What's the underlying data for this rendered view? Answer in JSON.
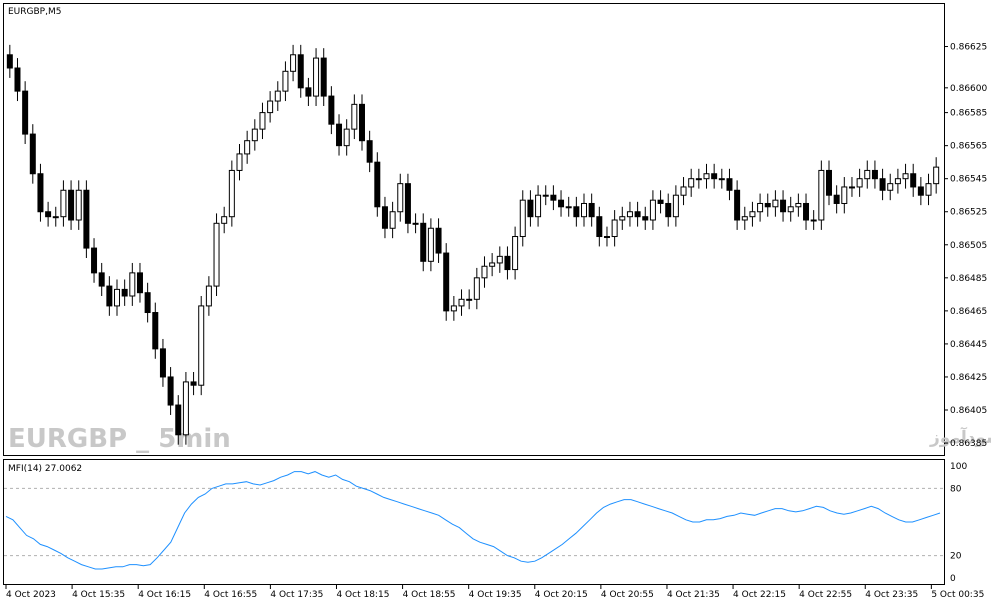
{
  "chart_data": [
    {
      "type": "candlestick",
      "title": "EURGBP,M5",
      "watermark": "EURGBP _ 5min",
      "watermark_rtl": "انتشار در سایت سودآموز",
      "ylim": [
        0.86382,
        0.86635
      ],
      "y_ticks": [
        "0.86625",
        "0.86600",
        "0.86585",
        "0.86565",
        "0.86545",
        "0.86525",
        "0.86505",
        "0.86485",
        "0.86465",
        "0.86445",
        "0.86425",
        "0.86405",
        "0.86385"
      ],
      "close_series": [
        0.86612,
        0.86598,
        0.86572,
        0.86548,
        0.86525,
        0.86522,
        0.86522,
        0.86538,
        0.8652,
        0.86538,
        0.86503,
        0.86488,
        0.8648,
        0.86468,
        0.86478,
        0.86474,
        0.86488,
        0.86476,
        0.86464,
        0.86442,
        0.86425,
        0.86408,
        0.8639,
        0.86422,
        0.8642,
        0.86468,
        0.8648,
        0.86518,
        0.86522,
        0.8655,
        0.8656,
        0.86568,
        0.86575,
        0.86585,
        0.86592,
        0.86598,
        0.8661,
        0.8662,
        0.866,
        0.86595,
        0.86618,
        0.86595,
        0.86578,
        0.86565,
        0.86575,
        0.8659,
        0.86568,
        0.86555,
        0.86528,
        0.86515,
        0.86525,
        0.86542,
        0.86518,
        0.86518,
        0.86495,
        0.86515,
        0.865,
        0.86465,
        0.86468,
        0.86472,
        0.86472,
        0.86485,
        0.86492,
        0.86494,
        0.86498,
        0.8649,
        0.8651,
        0.86532,
        0.86522,
        0.86535,
        0.86535,
        0.86532,
        0.86528,
        0.86528,
        0.86522,
        0.8653,
        0.86522,
        0.8651,
        0.8651,
        0.8652,
        0.86522,
        0.86525,
        0.86522,
        0.8652,
        0.86532,
        0.8653,
        0.86522,
        0.86535,
        0.8654,
        0.86545,
        0.86545,
        0.86548,
        0.86545,
        0.86545,
        0.86538,
        0.8652,
        0.86522,
        0.86525,
        0.8653,
        0.86528,
        0.86532,
        0.86525,
        0.86528,
        0.8653,
        0.8652,
        0.8652,
        0.8655,
        0.86535,
        0.8653,
        0.8654,
        0.8654,
        0.86545,
        0.8655,
        0.86545,
        0.86538,
        0.86542,
        0.86545,
        0.86548,
        0.8654,
        0.86535,
        0.86542,
        0.86552
      ]
    },
    {
      "type": "line",
      "title": "MFI(14) 27.0062",
      "ylim": [
        0,
        100
      ],
      "y_ticks": [
        "100",
        "80",
        "20",
        "0"
      ],
      "levels": [
        80,
        20
      ],
      "values": [
        55,
        52,
        45,
        38,
        35,
        30,
        28,
        25,
        22,
        18,
        15,
        12,
        10,
        8,
        8,
        9,
        10,
        10,
        12,
        12,
        11,
        12,
        18,
        25,
        32,
        45,
        58,
        66,
        72,
        75,
        80,
        82,
        84,
        84,
        85,
        86,
        84,
        83,
        85,
        87,
        90,
        92,
        95,
        95,
        93,
        95,
        92,
        90,
        92,
        88,
        86,
        82,
        80,
        78,
        75,
        72,
        70,
        68,
        66,
        64,
        62,
        60,
        58,
        56,
        52,
        48,
        45,
        40,
        35,
        32,
        30,
        28,
        24,
        20,
        18,
        15,
        14,
        15,
        18,
        22,
        26,
        30,
        35,
        40,
        46,
        52,
        58,
        63,
        66,
        68,
        70,
        70,
        68,
        66,
        64,
        62,
        60,
        58,
        55,
        52,
        50,
        50,
        52,
        52,
        53,
        55,
        56,
        58,
        57,
        56,
        58,
        60,
        62,
        62,
        60,
        59,
        60,
        62,
        64,
        63,
        60,
        58,
        57,
        58,
        60,
        62,
        64,
        62,
        58,
        55,
        52,
        50,
        50,
        52,
        54,
        56,
        58
      ]
    }
  ],
  "x_axis": {
    "labels": [
      "4 Oct 2023",
      "4 Oct 15:35",
      "4 Oct 16:15",
      "4 Oct 16:55",
      "4 Oct 17:35",
      "4 Oct 18:15",
      "4 Oct 18:55",
      "4 Oct 19:35",
      "4 Oct 20:15",
      "4 Oct 20:55",
      "4 Oct 21:35",
      "4 Oct 22:15",
      "4 Oct 22:55",
      "4 Oct 23:35",
      "5 Oct 00:35"
    ]
  }
}
